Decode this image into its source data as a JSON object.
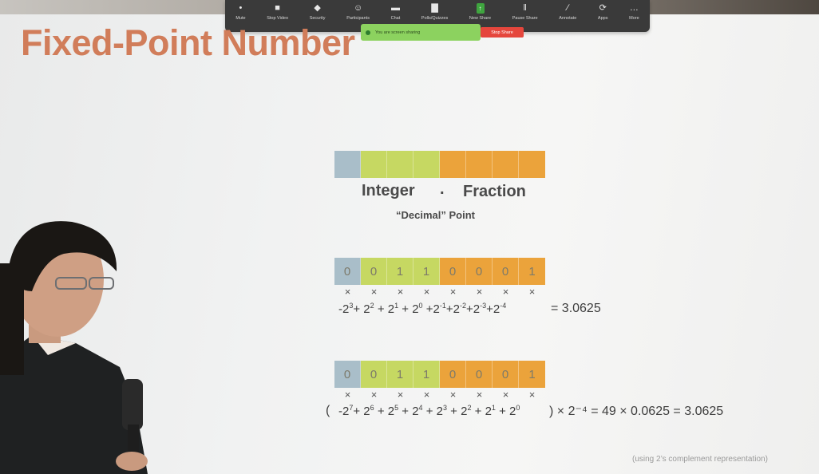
{
  "zoom_toolbar": {
    "items": [
      {
        "label": "Mute",
        "icon": "microphone-icon"
      },
      {
        "label": "Stop Video",
        "icon": "video-icon"
      },
      {
        "label": "Security",
        "icon": "shield-icon"
      },
      {
        "label": "Participants",
        "icon": "participants-icon"
      },
      {
        "label": "Chat",
        "icon": "chat-icon"
      },
      {
        "label": "Polls/Quizzes",
        "icon": "polls-icon"
      },
      {
        "label": "New Share",
        "icon": "share-icon"
      },
      {
        "label": "Pause Share",
        "icon": "pause-icon"
      },
      {
        "label": "Annotate",
        "icon": "pen-icon"
      },
      {
        "label": "Apps",
        "icon": "apps-icon"
      },
      {
        "label": "More",
        "icon": "more-icon"
      }
    ],
    "share_status": "You are screen sharing",
    "stop_share_label": "Stop Share"
  },
  "slide": {
    "title": "Fixed-Point Number",
    "format_labels": {
      "integer": "Integer",
      "point": ".",
      "fraction": "Fraction",
      "decimal_point": "“Decimal” Point"
    },
    "example1": {
      "bits": [
        "0",
        "0",
        "1",
        "1",
        "0",
        "0",
        "0",
        "1"
      ],
      "times_mark": "×",
      "formula_parts": [
        "-2",
        "3",
        "+ 2",
        "2",
        " + 2",
        "1",
        " + 2",
        "0",
        " +2",
        "-1",
        "+2",
        "-2",
        "+2",
        "-3",
        "+2",
        "-4"
      ],
      "result": "= 3.0625"
    },
    "example2": {
      "bits": [
        "0",
        "0",
        "1",
        "1",
        "0",
        "0",
        "0",
        "1"
      ],
      "times_mark": "×",
      "open_paren": "(",
      "formula_parts": [
        " -2",
        "7",
        "+ 2",
        "6",
        " + 2",
        "5",
        " + 2",
        "4",
        " + 2",
        "3",
        " + 2",
        "2",
        " + 2",
        "1",
        " + 2",
        "0"
      ],
      "result": ") × 2⁻⁴ = 49 × 0.0625 = 3.0625"
    },
    "footnote": "(using 2’s complement representation)"
  },
  "colors": {
    "title": "#d17d5a",
    "sign_bit": "#a9bec9",
    "integer_bits": "#c6d862",
    "fraction_bits": "#eba33b"
  }
}
